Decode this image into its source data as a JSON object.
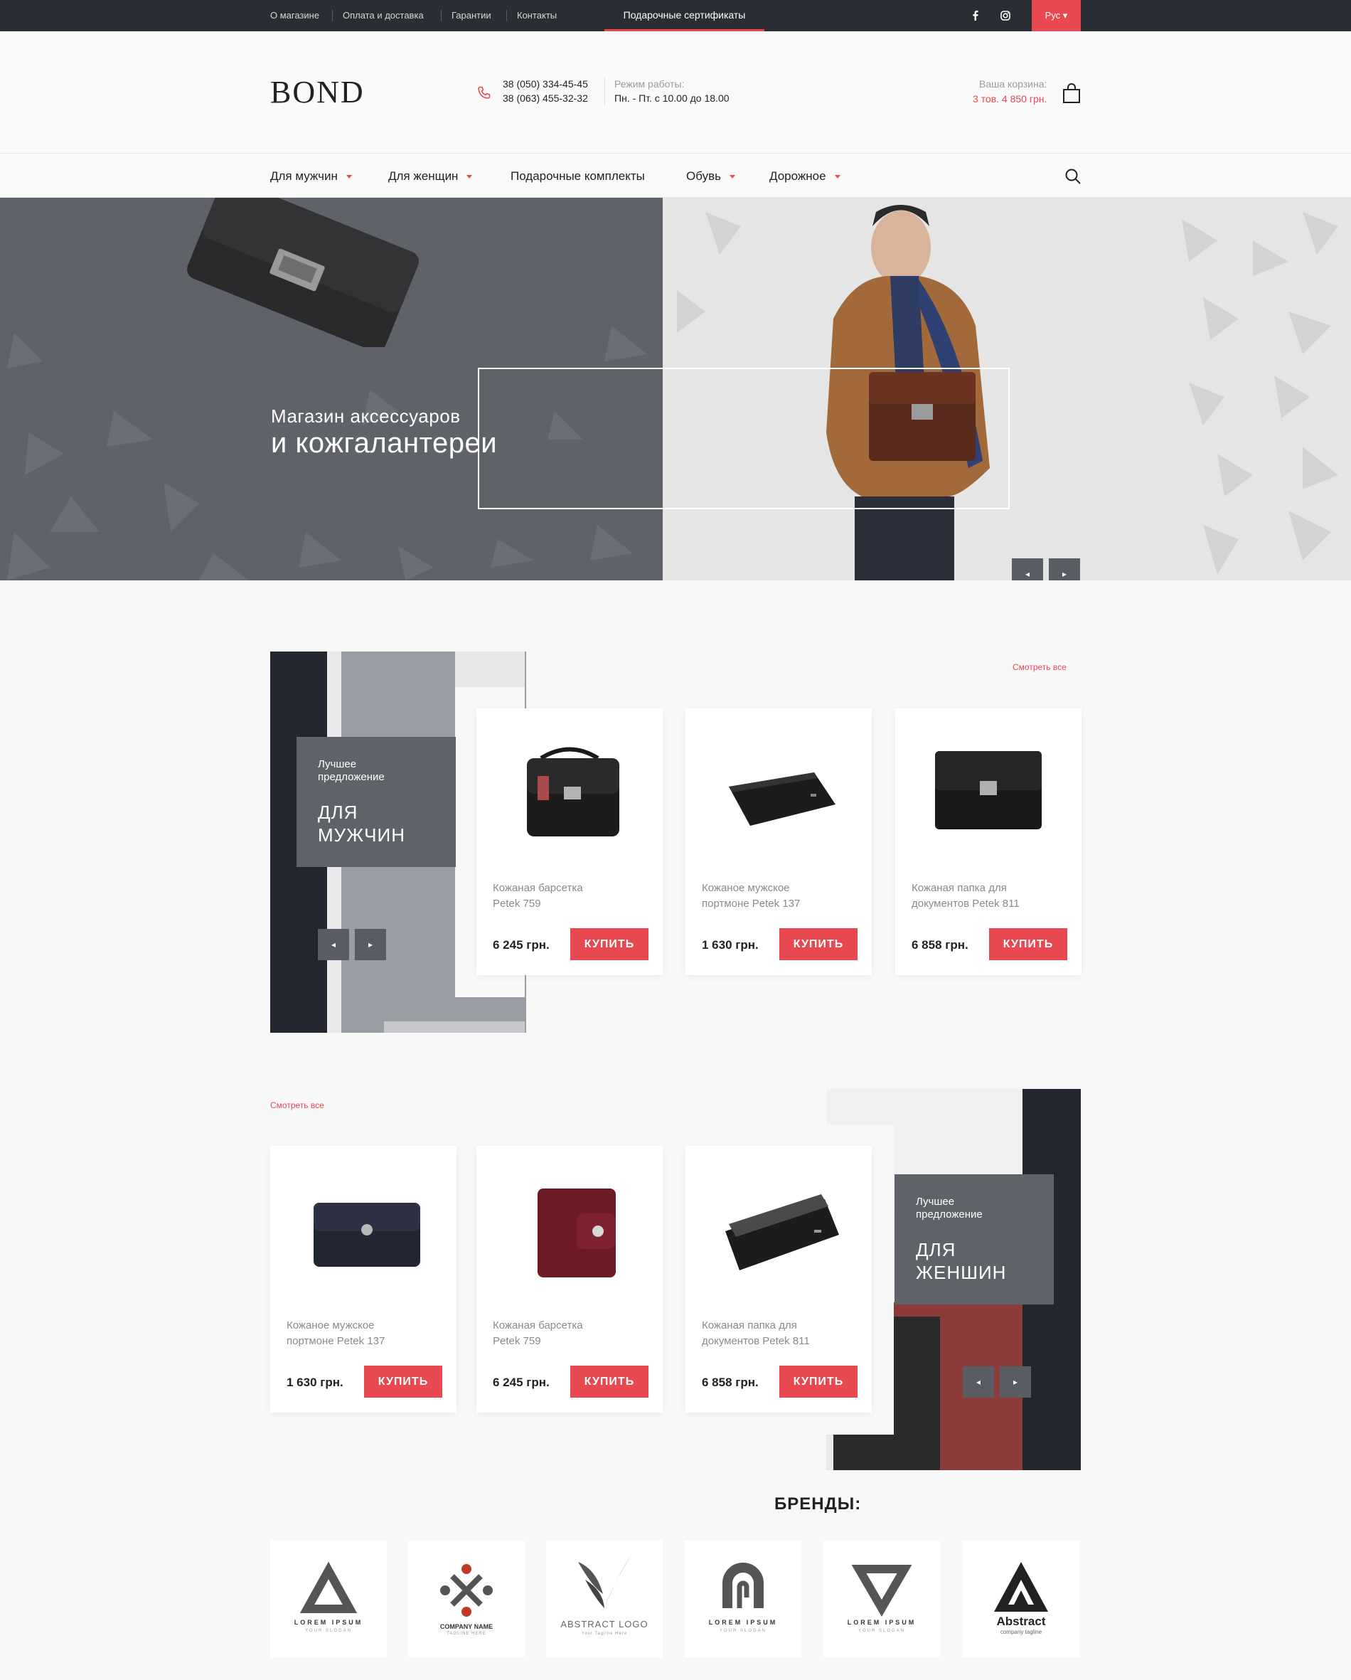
{
  "topbar": {
    "links": [
      "О магазине",
      "Оплата и доставка",
      "Гарантии",
      "Контакты"
    ],
    "gift_certificates": "Подарочные сертификаты",
    "language": "Рус ▾",
    "social_icons": [
      "facebook-icon",
      "instagram-icon"
    ]
  },
  "header": {
    "logo": "BOND",
    "phone1": "38 (050) 334-45-45",
    "phone2": "38 (063) 455-32-32",
    "hours_label": "Режим работы:",
    "hours": "Пн. - Пт. с 10.00 до 18.00",
    "cart_label": "Ваша корзина:",
    "cart_value": "3 тов. 4 850 грн."
  },
  "nav": {
    "items": [
      "Для мужчин",
      "Для женщин",
      "Подарочные комплекты",
      "Обувь",
      "Дорожное"
    ]
  },
  "hero": {
    "line1": "Магазин аксессуаров",
    "line2": "и кожгалантереи"
  },
  "men": {
    "view_all": "Смотреть все",
    "promo_small": "Лучшее предложение",
    "promo_big": "ДЛЯ МУЖЧИН",
    "products": [
      {
        "name": "Кожаная барсетка Petek 759",
        "price": "6 245 грн.",
        "buy": "КУПИТЬ"
      },
      {
        "name": "Кожаное мужское портмоне Petek 137",
        "price": "1 630 грн.",
        "buy": "КУПИТЬ"
      },
      {
        "name": "Кожаная папка для документов Petek 811",
        "price": "6 858 грн.",
        "buy": "КУПИТЬ"
      }
    ]
  },
  "women": {
    "view_all": "Смотреть все",
    "promo_small": "Лучшее предложение",
    "promo_big": "ДЛЯ ЖЕНШИН",
    "products": [
      {
        "name": "Кожаное мужское портмоне Petek 137",
        "price": "1 630 грн.",
        "buy": "КУПИТЬ"
      },
      {
        "name": "Кожаная барсетка Petek 759",
        "price": "6 245 грн.",
        "buy": "КУПИТЬ"
      },
      {
        "name": "Кожаная папка для документов Petek 811",
        "price": "6 858 грн.",
        "buy": "КУПИТЬ"
      }
    ]
  },
  "brands": {
    "title": "БРЕНДЫ:",
    "logos": [
      {
        "name": "LOREM IPSUM",
        "tagline": "YOUR SLOGAN"
      },
      {
        "name": "COMPANY NAME",
        "tagline": "TAGLINE HERE"
      },
      {
        "name": "ABSTRACT LOGO",
        "tagline": "Your Tagline Here"
      },
      {
        "name": "LOREM IPSUM",
        "tagline": "YOUR SLOGAN"
      },
      {
        "name": "LOREM IPSUM",
        "tagline": "YOUR SLOGAN"
      },
      {
        "name": "Abstract",
        "tagline": "company tagline"
      }
    ]
  },
  "colors": {
    "accent": "#e8484f",
    "dark": "#2b2d34",
    "gray": "#5f6268"
  }
}
